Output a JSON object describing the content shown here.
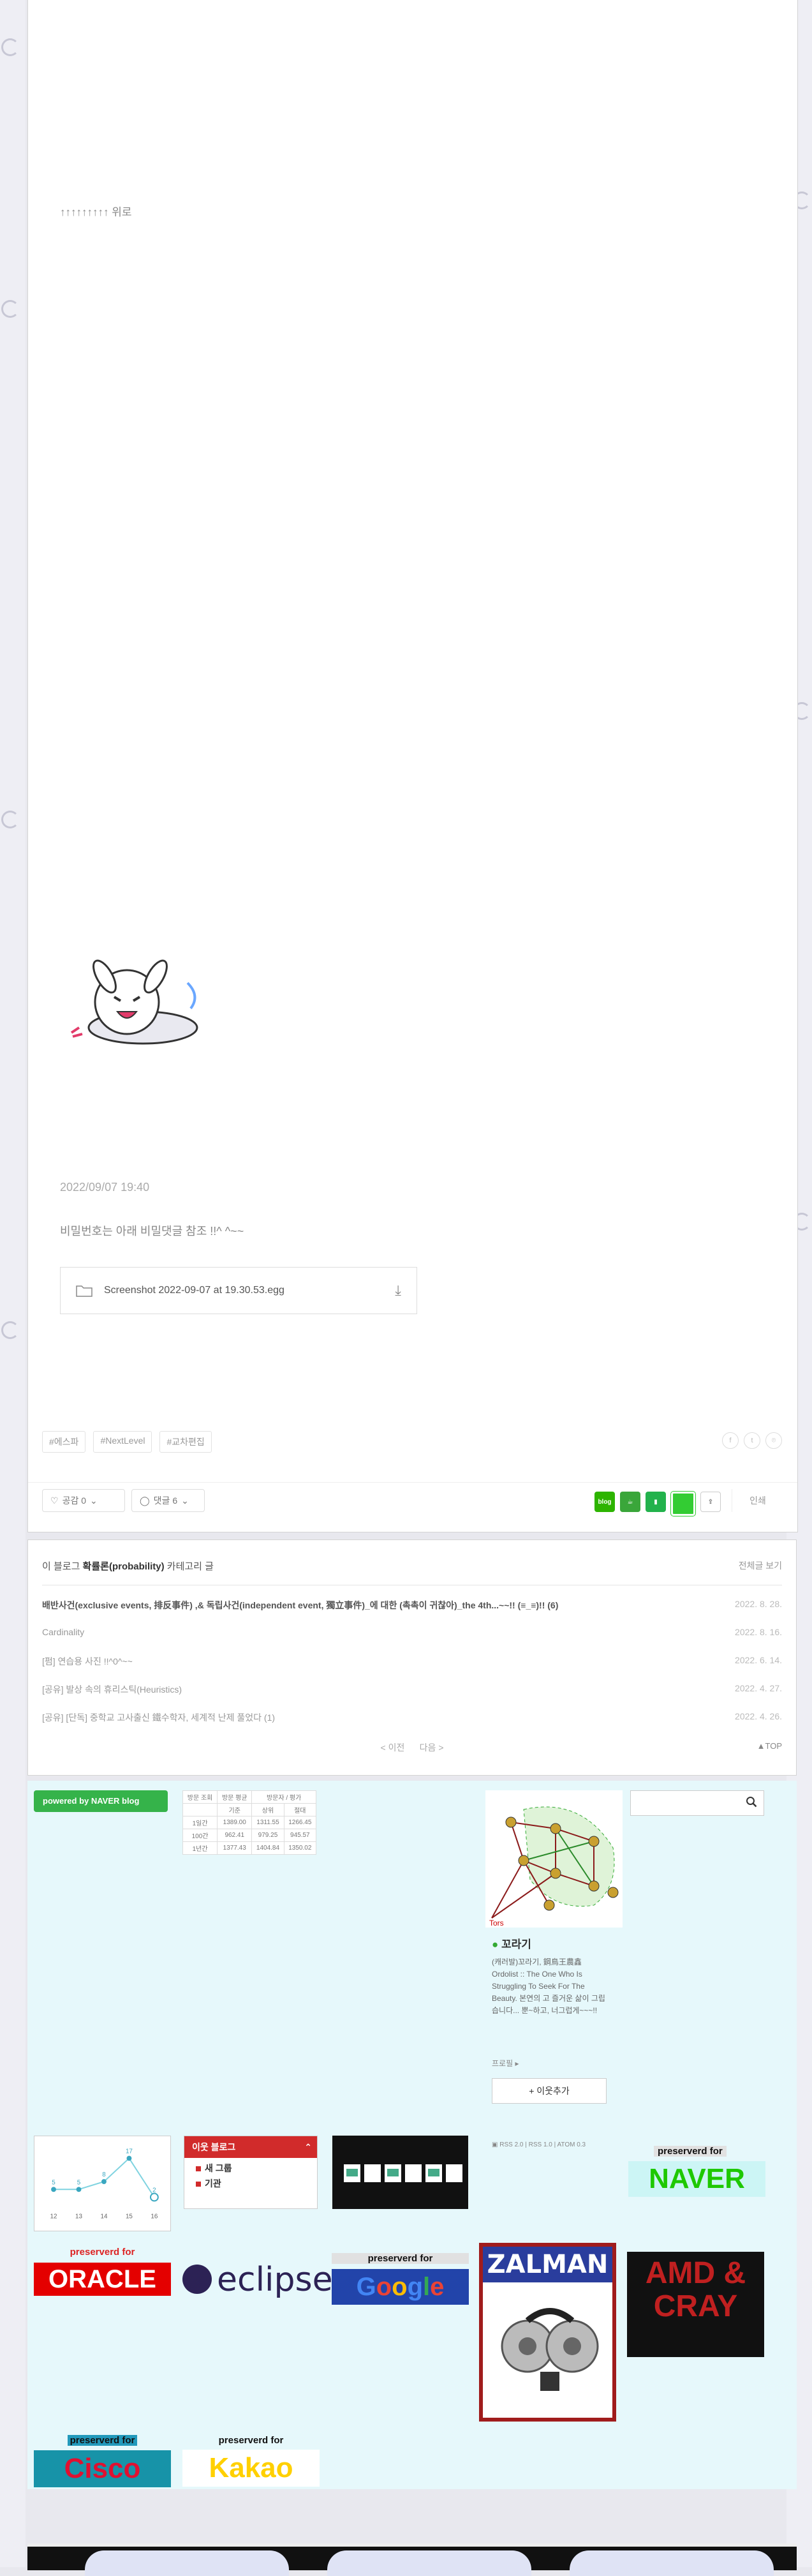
{
  "post": {
    "up_link": "↑↑↑↑↑↑↑↑↑ 위로",
    "date": "2022/09/07   19:40",
    "body_text": "비밀번호는 아래 비밀댓글 참조 !!^ ^~~",
    "attachment": {
      "file_name": "Screenshot 2022-09-07 at 19.30.53.egg",
      "icon": "folder-icon",
      "download_icon": "download-icon"
    },
    "emoticon": "crying-bunny-emoticon",
    "tags": [
      "#에스파",
      "#NextLevel",
      "#교차편집"
    ],
    "like_label": "공감 0",
    "comment_label": "댓글 6",
    "print_label": "인쇄",
    "share_badge": "blog"
  },
  "category_list": {
    "header_prefix": "이 블로그",
    "category": "확률론(probability)",
    "header_suffix": "카테고리 글",
    "all_posts": "전체글 보기",
    "rows": [
      {
        "title": "배반사건(exclusive events, 排反事件) ,& 독립사건(independent event, 獨立事件)_에 대한 (촉촉이 귀찮아)_the 4th...~~!! (≡_≡)!! (6)",
        "date": "2022. 8. 28."
      },
      {
        "title": "Cardinality",
        "date": "2022. 8. 16."
      },
      {
        "title": "[펌] 연습용 사진 !!^0^~~",
        "date": "2022. 6. 14."
      },
      {
        "title": "[공유] 발상 속의 휴리스틱(Heuristics)",
        "date": "2022. 4. 27."
      },
      {
        "title": "[공유] [단독] 중학교 고사출신 鐵수학자, 세계적 난제 풀었다 (1)",
        "date": "2022. 4. 26."
      }
    ],
    "prev": "< 이전",
    "next": "다음 >",
    "top": "▲TOP"
  },
  "widgets": {
    "powered_by": "powered by NAVER blog",
    "visit_table": {
      "tabs": [
        "방문 조회",
        "방문 평균",
        "방문자 / 평가"
      ],
      "headers": [
        "",
        "기준",
        "상위",
        "절대"
      ],
      "rows": [
        [
          "1일간",
          "1389.00",
          "1311.55",
          "1266.45"
        ],
        [
          "100간",
          "962.41",
          "979.25",
          "945.57"
        ],
        [
          "1년간",
          "1377.43",
          "1404.84",
          "1350.02"
        ]
      ]
    },
    "profile": {
      "name": "꼬라기",
      "description": "(캐러발)꼬라기, 鋼鳥王農鑫 Ordolist :: The One Who Is Struggling To Seek For The Beauty. 본연의 고 즐거운 삶이 그립습니다... 뿐~하고, 너그럽게~~~!!",
      "more": "프로필 ▸",
      "neighbor_button": "+ 이웃추가"
    },
    "search_icon": "search-icon",
    "rss": "RSS 2.0 | RSS 1.0 | ATOM 0.3",
    "visitor_chart": {
      "labels": [
        "12",
        "13",
        "14",
        "15",
        "16"
      ],
      "values": [
        5,
        5,
        8,
        17,
        2
      ]
    },
    "neighbor_blog": {
      "title": "이웃 블로그",
      "items": [
        "새 그룹",
        "기관"
      ]
    },
    "logos": {
      "naver": {
        "caption": "preserverd for",
        "name": "NAVER"
      },
      "oracle": {
        "caption": "preserverd for",
        "name": "ORACLE"
      },
      "eclipse": {
        "name": "eclipse"
      },
      "google": {
        "caption": "preserverd for",
        "name": "Google"
      },
      "zalman": {
        "name": "ZALMAN"
      },
      "amd": {
        "name": "AMD & CRAY"
      },
      "cisco": {
        "caption": "preserverd for",
        "name": "Cisco"
      },
      "kakao": {
        "caption": "preserverd for",
        "name": "Kakao"
      }
    }
  },
  "colors": {
    "naver_green": "#35b34a",
    "accent_red": "#d12b2b",
    "widget_bg": "#e6f8fb"
  }
}
